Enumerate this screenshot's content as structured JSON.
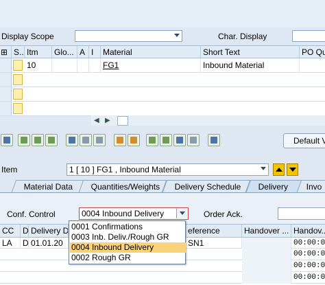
{
  "top": {
    "display_scope_label": "Display Scope",
    "char_display_label": "Char. Display"
  },
  "items_table": {
    "headers": [
      "S..",
      "Itm",
      "Glo...",
      "A",
      "I",
      "Material",
      "Short Text",
      "PO Quan"
    ],
    "rows": [
      {
        "itm": "10",
        "material": "FG1",
        "short_text": "Inbound Material"
      }
    ]
  },
  "toolbar": {
    "default_button": "Default V"
  },
  "item": {
    "label": "Item",
    "value": "1 [ 10 ] FG1 , Inbound Material"
  },
  "tabs": [
    "Material Data",
    "Quantities/Weights",
    "Delivery Schedule",
    "Delivery",
    "Invo"
  ],
  "detail": {
    "conf_control_label": "Conf. Control",
    "conf_control_value": "0004 Inbound Delivery",
    "order_ack_label": "Order Ack.",
    "headers": [
      "CC",
      "D",
      "Delivery D",
      "",
      "eference",
      "Handover ...",
      "Handov..."
    ],
    "row": {
      "cc": "LA",
      "d": "D",
      "date": "01.01.20",
      "ref": "SN1",
      "handover_time": "00:00:0"
    },
    "time_rows": [
      "00:00:0",
      "00:00:0",
      "00:00:0",
      "00:00:0"
    ]
  },
  "dropdown": {
    "options": [
      "0001 Confirmations",
      "0003 Inb. Deliv./Rough GR",
      "0004 Inbound Delivery",
      "0002 Rough GR"
    ],
    "selected_index": 2
  }
}
